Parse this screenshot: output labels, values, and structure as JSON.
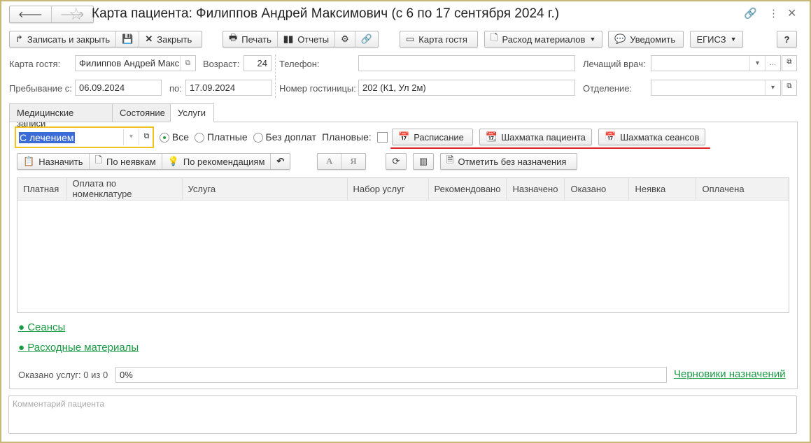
{
  "title": "Карта пациента: Филиппов Андрей Максимович (с 6 по 17 сентября 2024 г.)",
  "toolbar": {
    "save_close": "Записать и закрыть",
    "close": "Закрыть",
    "print": "Печать",
    "reports": "Отчеты",
    "guest_card": "Карта гостя",
    "materials": "Расход материалов",
    "notify": "Уведомить",
    "egisz": "ЕГИСЗ",
    "help": "?"
  },
  "form": {
    "guest_card_label": "Карта гостя:",
    "guest_card_value": "Филиппов Андрей Макс",
    "age_label": "Возраст:",
    "age_value": "24",
    "phone_label": "Телефон:",
    "phone_value": "",
    "doctor_label": "Лечащий врач:",
    "doctor_value": "",
    "stay_from_label": "Пребывание с:",
    "stay_from_value": "06.09.2024",
    "stay_to_label": "по:",
    "stay_to_value": "17.09.2024",
    "room_label": "Номер гостиницы:",
    "room_value": "202 (К1, Ул 2м)",
    "department_label": "Отделение:",
    "department_value": ""
  },
  "tabs": [
    {
      "label": "Медицинские записи"
    },
    {
      "label": "Состояние"
    },
    {
      "label": "Услуги",
      "active": true
    }
  ],
  "services": {
    "filter_value": "С лечением",
    "radios": [
      {
        "label": "Все",
        "checked": true
      },
      {
        "label": "Платные"
      },
      {
        "label": "Без доплат"
      }
    ],
    "planned_label": "Плановые:",
    "schedule": "Расписание",
    "patient_chess": "Шахматка пациента",
    "session_chess": "Шахматка сеансов",
    "assign": "Назначить",
    "by_noshow": "По неявкам",
    "by_recommend": "По рекомендациям",
    "font_a": "А",
    "font_ya": "Я",
    "mark_without": "Отметить без назначения",
    "columns": [
      "Платная",
      "Оплата по номенклатуре",
      "Услуга",
      "Набор услуг",
      "Рекомендовано",
      "Назначено",
      "Оказано",
      "Неявка",
      "Оплачена"
    ],
    "sessions_link": "● Сеансы",
    "materials_link": "● Расходные материалы",
    "provided_label": "Оказано услуг: 0 из 0",
    "progress_text": "0%",
    "progress": 0,
    "drafts_link": "Черновики назначений"
  },
  "comment_placeholder": "Комментарий пациента"
}
